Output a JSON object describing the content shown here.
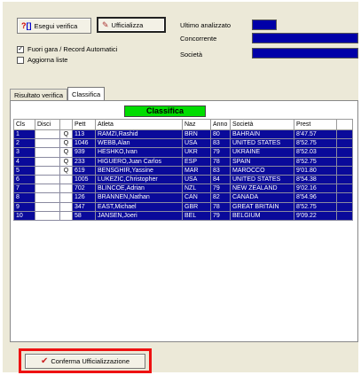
{
  "toolbar": {
    "verify_label": "Esegui verifica",
    "officialize_label": "Ufficializza",
    "auto_records_label": "Fuori gara / Record Automatici",
    "auto_records_checked": true,
    "update_lists_label": "Aggiorna liste",
    "update_lists_checked": false
  },
  "info": {
    "last_analyzed_label": "Ultimo analizzato",
    "competitor_label": "Concorrente",
    "society_label": "Società"
  },
  "tabs": [
    {
      "label": "Risultato verifica",
      "active": false
    },
    {
      "label": "Classifica",
      "active": true
    }
  ],
  "ranking": {
    "title": "Classifica",
    "columns": [
      "Cls",
      "Disci",
      "",
      "Pett",
      "Atleta",
      "Naz",
      "Anno",
      "Società",
      "Prest"
    ],
    "rows": [
      {
        "cls": "1",
        "disci": "",
        "q": "Q",
        "pett": "113",
        "atleta": "RAMZI,Rashid",
        "naz": "BRN",
        "anno": "80",
        "societa": "BAHRAIN",
        "prest": "8'47.57"
      },
      {
        "cls": "2",
        "disci": "",
        "q": "Q",
        "pett": "1046",
        "atleta": "WEBB,Alan",
        "naz": "USA",
        "anno": "83",
        "societa": "UNITED STATES",
        "prest": "8'52.75"
      },
      {
        "cls": "3",
        "disci": "",
        "q": "Q",
        "pett": "939",
        "atleta": "HESHKO,Ivan",
        "naz": "UKR",
        "anno": "79",
        "societa": "UKRAINE",
        "prest": "8'52.03"
      },
      {
        "cls": "4",
        "disci": "",
        "q": "Q",
        "pett": "233",
        "atleta": "HIGUERO,Juan Carlos",
        "naz": "ESP",
        "anno": "78",
        "societa": "SPAIN",
        "prest": "8'52.75"
      },
      {
        "cls": "5",
        "disci": "",
        "q": "Q",
        "pett": "619",
        "atleta": "BENSGHIR,Yassine",
        "naz": "MAR",
        "anno": "83",
        "societa": "MAROCCO",
        "prest": "9'01.80"
      },
      {
        "cls": "6",
        "disci": "",
        "q": "",
        "pett": "1005",
        "atleta": "LUKEZIC,Christopher",
        "naz": "USA",
        "anno": "84",
        "societa": "UNITED STATES",
        "prest": "8'54.38"
      },
      {
        "cls": "7",
        "disci": "",
        "q": "",
        "pett": "702",
        "atleta": "BLINCOE,Adrian",
        "naz": "NZL",
        "anno": "79",
        "societa": "NEW ZEALAND",
        "prest": "9'02.16"
      },
      {
        "cls": "8",
        "disci": "",
        "q": "",
        "pett": "126",
        "atleta": "BRANNEN,Nathan",
        "naz": "CAN",
        "anno": "82",
        "societa": "CANADA",
        "prest": "8'54.96"
      },
      {
        "cls": "9",
        "disci": "",
        "q": "",
        "pett": "347",
        "atleta": "EAST,Michael",
        "naz": "GBR",
        "anno": "78",
        "societa": "GREAT BRITAIN",
        "prest": "8'52.75"
      },
      {
        "cls": "10",
        "disci": "",
        "q": "",
        "pett": "58",
        "atleta": "JANSEN,Joeri",
        "naz": "BEL",
        "anno": "79",
        "societa": "BELGIUM",
        "prest": "9'09.22"
      }
    ]
  },
  "footer": {
    "confirm_label": "Conferma Ufficializzazione"
  },
  "colors": {
    "selection": "#0a0a9a",
    "title_bg": "#00dd00",
    "highlight_border": "#ee1111",
    "window_bg": "#ece9d8"
  }
}
